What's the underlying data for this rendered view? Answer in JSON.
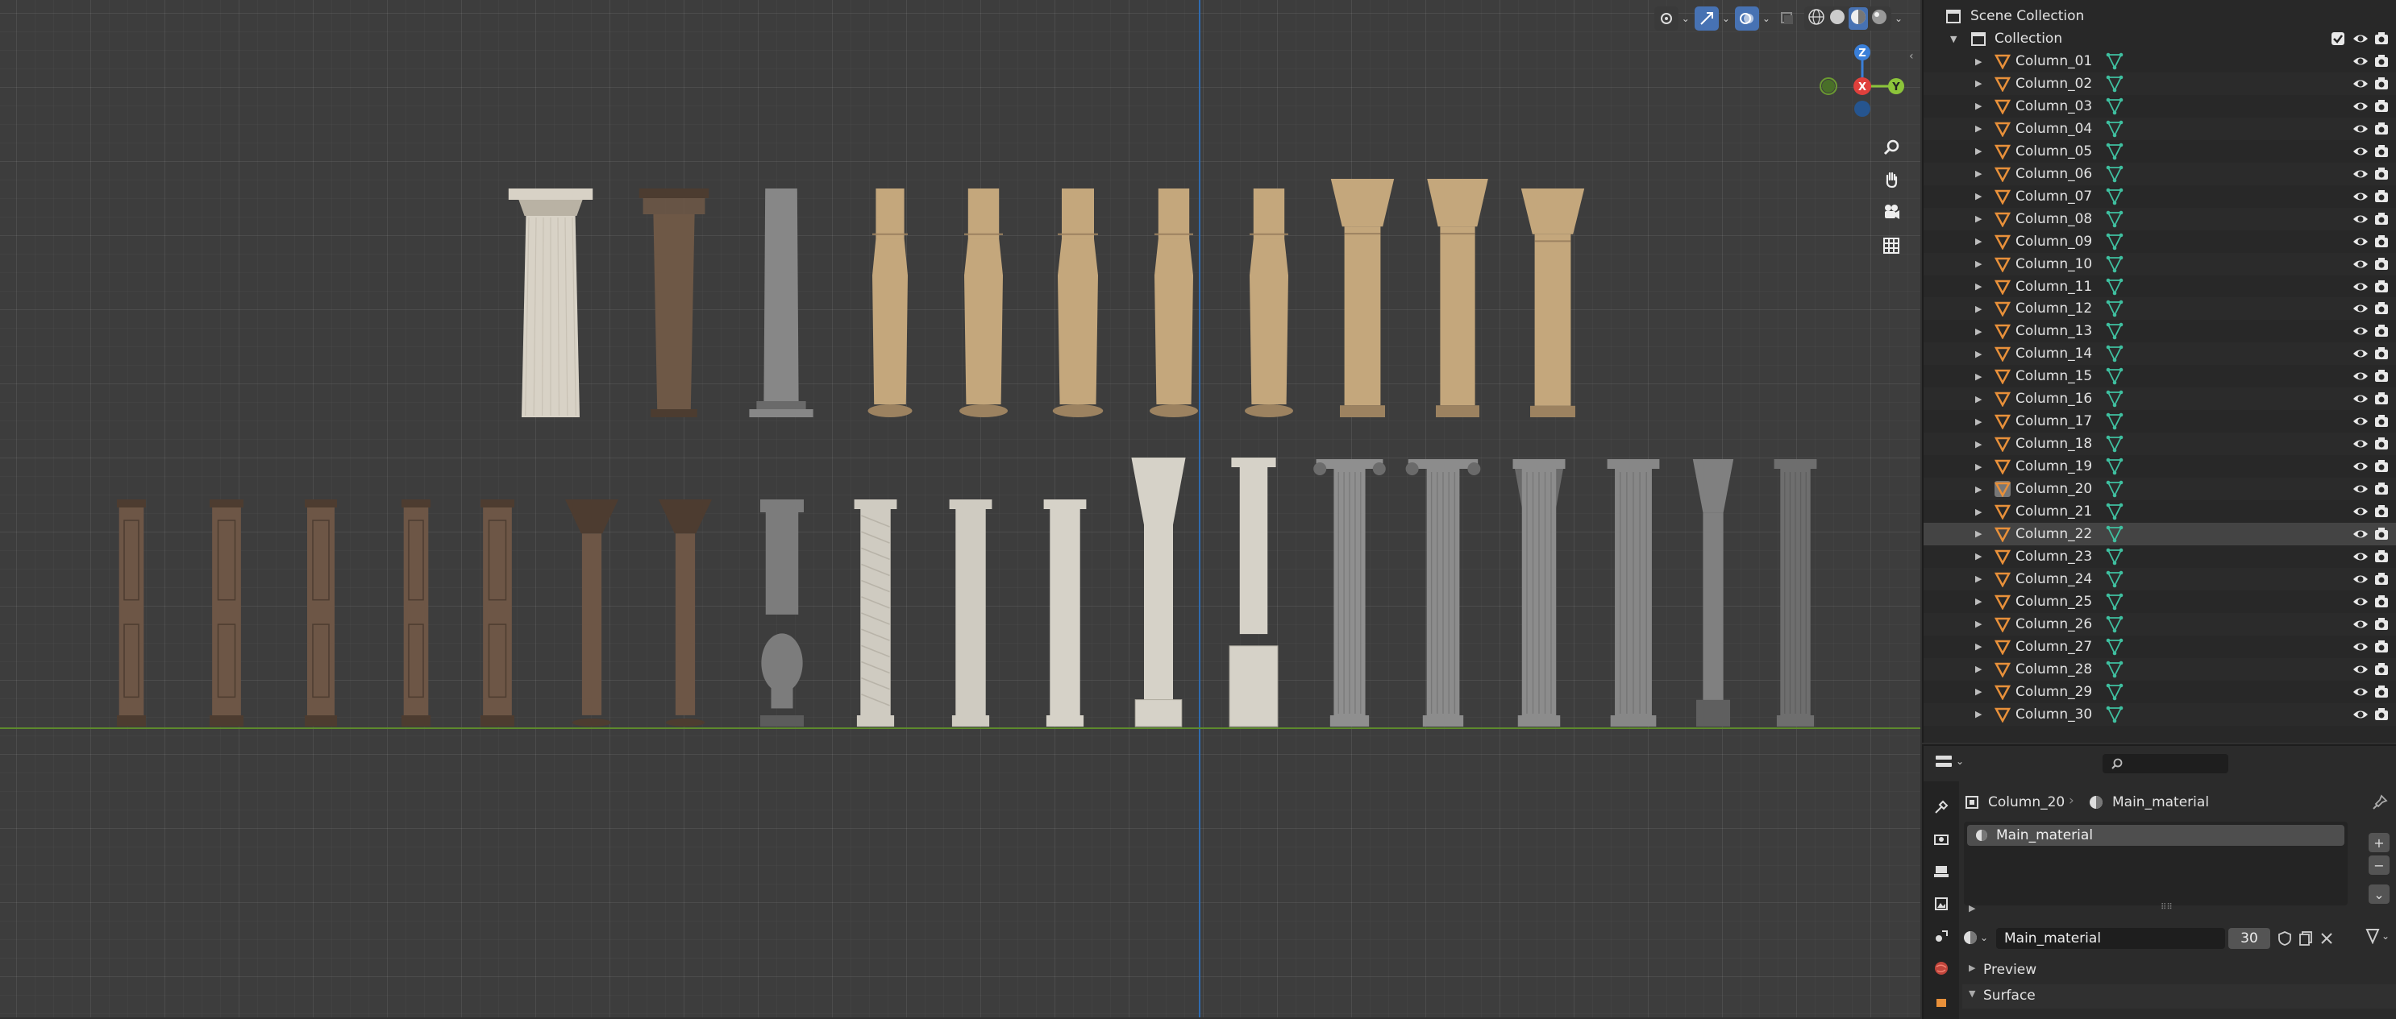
{
  "viewport": {
    "header_icons": [
      "view-object-types-icon",
      "gizmo-toggle-icon",
      "overlay-toggle-icon",
      "xray-icon",
      "wireframe-shading-icon",
      "solid-shading-icon",
      "material-preview-shading-icon",
      "rendered-shading-icon"
    ],
    "gizmo": {
      "z_label": "Z",
      "y_label": "Y",
      "x_label": "X"
    },
    "nav_tools": [
      "zoom-icon",
      "pan-hand-icon",
      "camera-view-icon",
      "ortho-grid-icon"
    ]
  },
  "outliner": {
    "scene_collection_label": "Scene Collection",
    "collection_label": "Collection",
    "selected_item": "Column_22",
    "active_material_item": "Column_20",
    "items": [
      "Column_01",
      "Column_02",
      "Column_03",
      "Column_04",
      "Column_05",
      "Column_06",
      "Column_07",
      "Column_08",
      "Column_09",
      "Column_10",
      "Column_11",
      "Column_12",
      "Column_13",
      "Column_14",
      "Column_15",
      "Column_16",
      "Column_17",
      "Column_18",
      "Column_19",
      "Column_20",
      "Column_21",
      "Column_22",
      "Column_23",
      "Column_24",
      "Column_25",
      "Column_26",
      "Column_27",
      "Column_28",
      "Column_29",
      "Column_30"
    ],
    "colors": {
      "mesh_orange": "#e8903a",
      "vertex_green": "#3fc0a0"
    }
  },
  "properties": {
    "search_placeholder": "",
    "breadcrumb_object": "Column_20",
    "breadcrumb_material": "Main_material",
    "material_slot": "Main_material",
    "material_name": "Main_material",
    "user_count": "30",
    "panel_preview": "Preview",
    "panel_surface": "Surface"
  }
}
